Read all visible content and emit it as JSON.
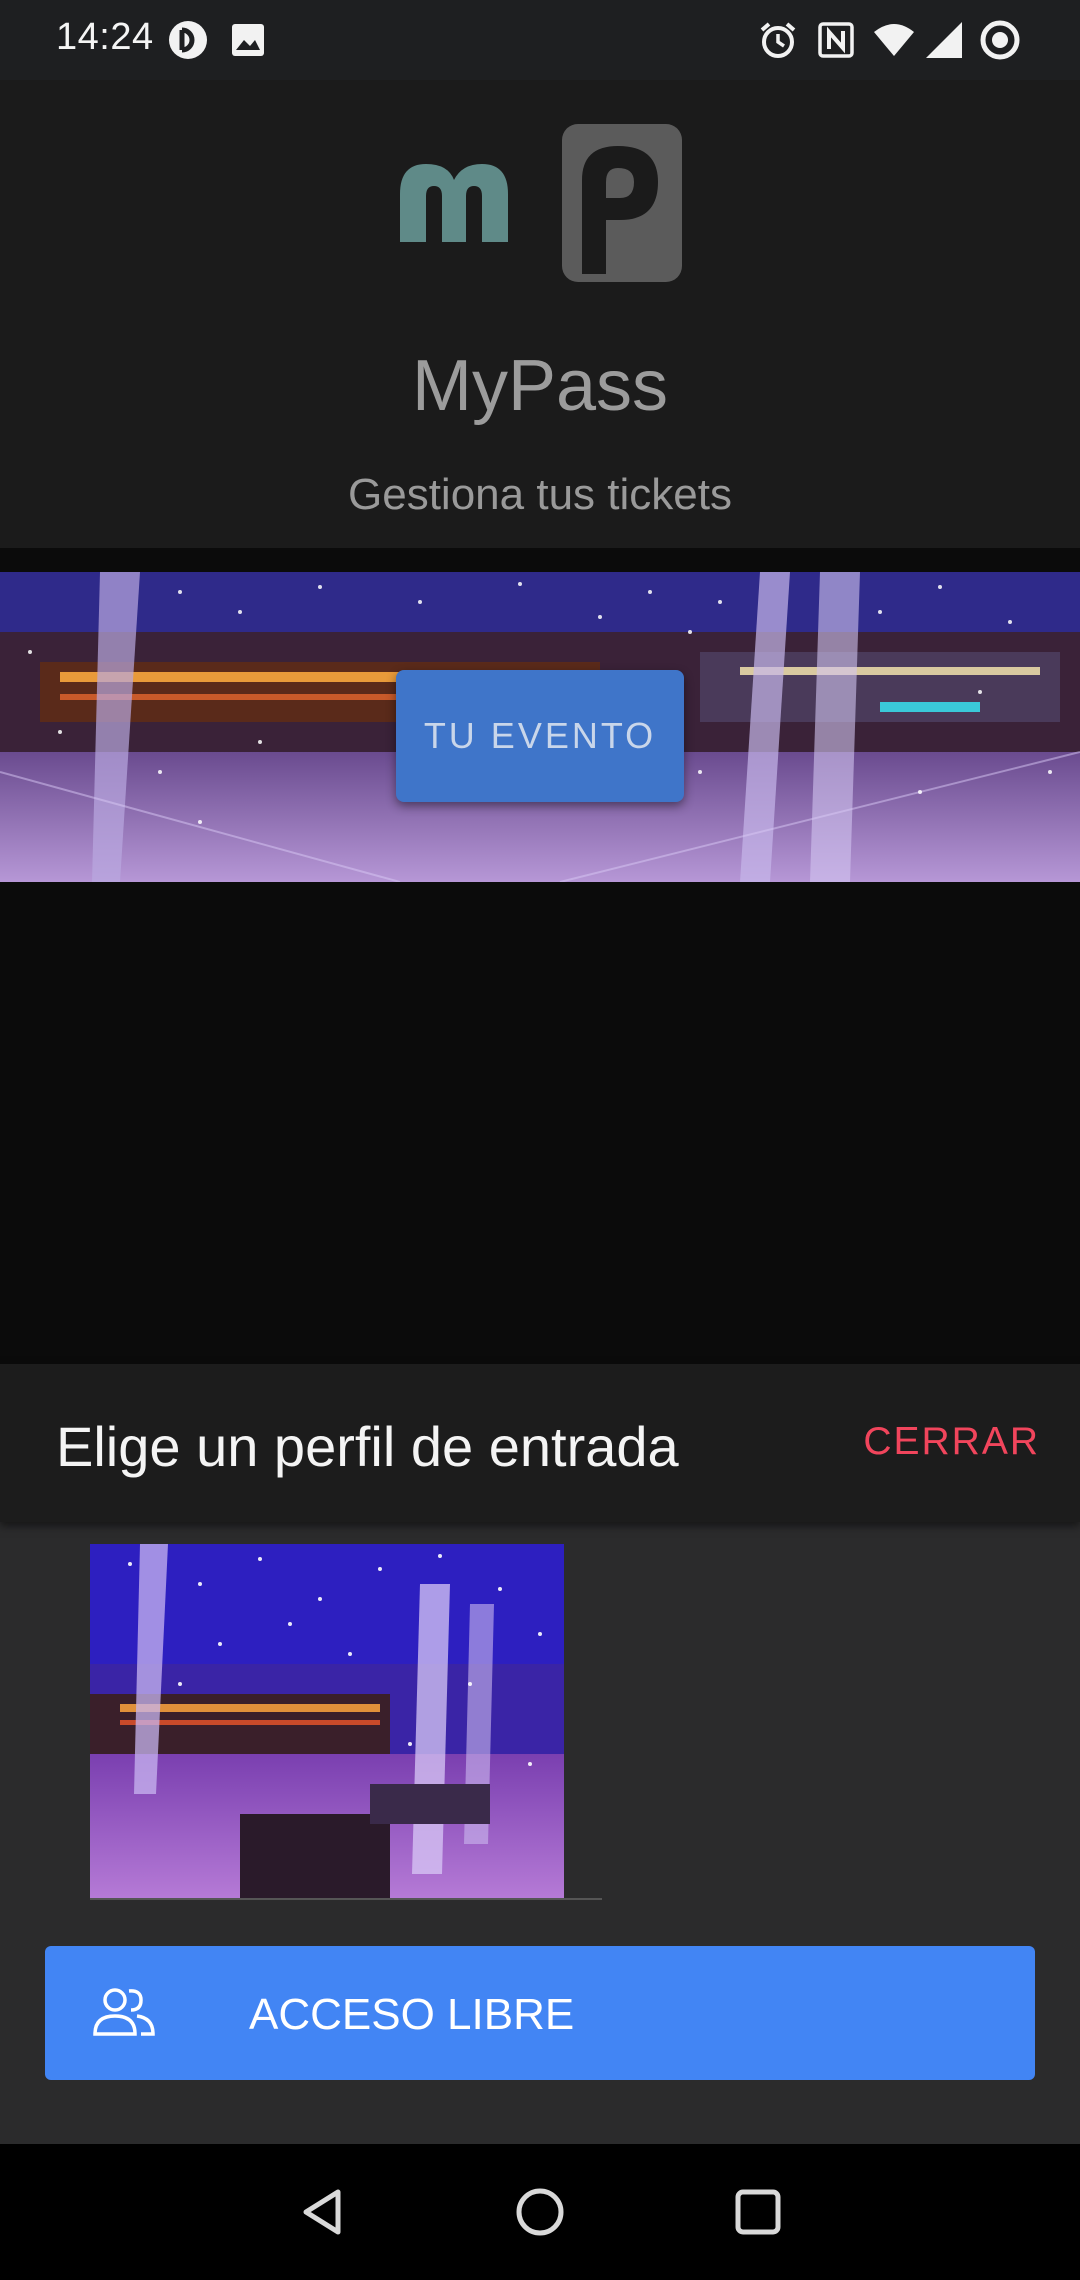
{
  "status_bar": {
    "time": "14:24",
    "left_icons": [
      "pocketcasts-icon",
      "gallery-icon"
    ],
    "right_icons": [
      "alarm-icon",
      "nfc-icon",
      "wifi-icon",
      "signal-icon",
      "battery-ring-icon"
    ]
  },
  "header": {
    "logo_alt": "mp",
    "title": "MyPass",
    "subtitle": "Gestiona tus tickets"
  },
  "banner": {
    "button_label": "TU EVENTO"
  },
  "sheet": {
    "title": "Elige un perfil de entrada",
    "close_label": "CERRAR",
    "access_button_label": "ACCESO LIBRE",
    "access_icon": "people-icon"
  },
  "nav": {
    "buttons": [
      "back-icon",
      "home-icon",
      "recents-icon"
    ]
  },
  "colors": {
    "accent_blue": "#4285f4",
    "event_button_blue": "#3f75c9",
    "close_red": "#f1455c",
    "logo_teal": "#5f8a88",
    "logo_grey": "#5b5b5b"
  }
}
